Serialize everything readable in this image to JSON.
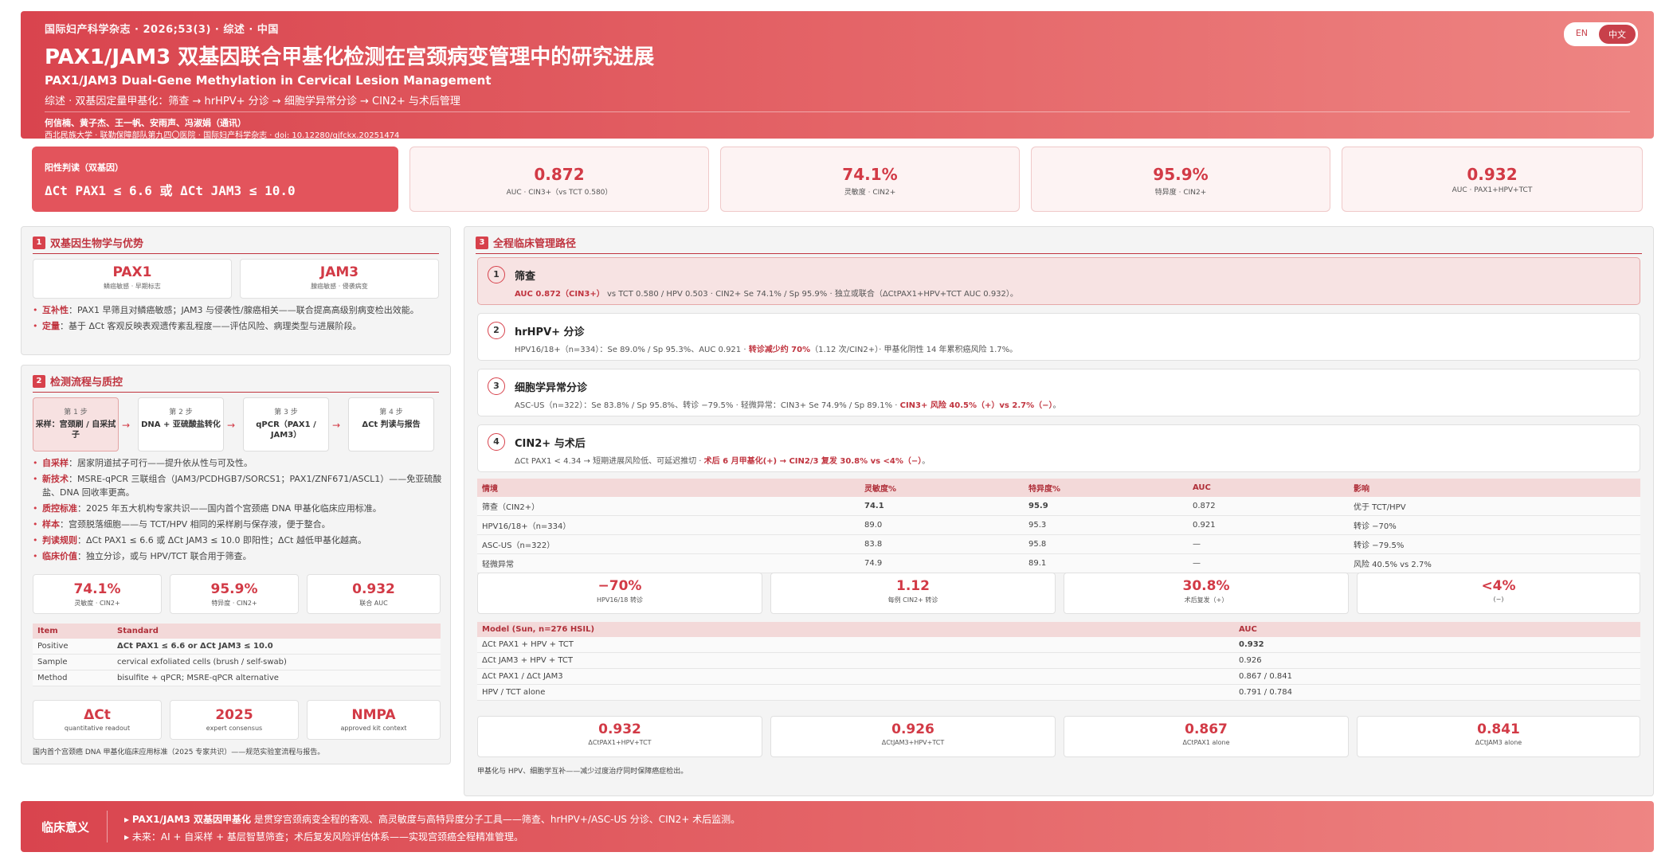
{
  "header": {
    "journal": "国际妇产科学杂志 · 2026;53(3) · 综述 · 中国",
    "title": "PAX1/JAM3 双基因联合甲基化检测在宫颈病变管理中的研究进展",
    "subtitle_en": "PAX1/JAM3 Dual-Gene Methylation in Cervical Lesion Management",
    "topic": "综述 · 双基因定量甲基化：筛查 → hrHPV+ 分诊 → 细胞学异常分诊 → CIN2+ 与术后管理",
    "authors": "何信楠、黄子杰、王一帆、安雨声、冯淑娟（通讯）",
    "affiliation": "西北民族大学 · 联勤保障部队第九四〇医院 · 国际妇产科学杂志 · doi: ",
    "doi": "10.12280/gjfckx.20251474",
    "lang_en": "EN",
    "lang_zh": "中文"
  },
  "kpis": {
    "main_label": "阳性判读（双基因）",
    "main_value": "ΔCt PAX1 ≤ 6.6 或 ΔCt JAM3 ≤ 10.0",
    "cards": [
      {
        "value": "0.872",
        "label": "AUC · CIN3+（vs TCT 0.580）"
      },
      {
        "value": "74.1%",
        "label": "灵敏度 · CIN2+"
      },
      {
        "value": "95.9%",
        "label": "特异度 · CIN2+"
      },
      {
        "value": "0.932",
        "label": "AUC · PAX1+HPV+TCT"
      }
    ]
  },
  "section1": {
    "num": "1",
    "title": "双基因生物学与优势",
    "genes": [
      {
        "name": "PAX1",
        "desc": "鳞癌敏感 · 早期标志"
      },
      {
        "name": "JAM3",
        "desc": "腺癌敏感 · 侵袭病变"
      }
    ],
    "bullets": [
      {
        "key": "互补性",
        "text": "：PAX1 早筛且对鳞癌敏感；JAM3 与侵袭性/腺癌相关——联合提高高级别病变检出效能。"
      },
      {
        "key": "定量",
        "text": "：基于 ΔCt 客观反映表观遗传紊乱程度——评估风险、病理类型与进展阶段。"
      }
    ]
  },
  "section2": {
    "num": "2",
    "title": "检测流程与质控",
    "steps": [
      {
        "n": "第 1 步",
        "t": "采样：宫颈刷 / 自采拭子"
      },
      {
        "n": "第 2 步",
        "t": "DNA + 亚硫酸盐转化"
      },
      {
        "n": "第 3 步",
        "t": "qPCR（PAX1 / JAM3）"
      },
      {
        "n": "第 4 步",
        "t": "ΔCt 判读与报告"
      }
    ],
    "arrow": "→",
    "bullets": [
      {
        "key": "自采样",
        "text": "：居家阴道拭子可行——提升依从性与可及性。"
      },
      {
        "key": "新技术",
        "text": "：MSRE-qPCR 三联组合（JAM3/PCDHGB7/SORCS1；PAX1/ZNF671/ASCL1）——免亚硫酸盐、DNA 回收率更高。"
      },
      {
        "key": "质控标准",
        "text": "：2025 年五大机构专家共识——国内首个宫颈癌 DNA 甲基化临床应用标准。"
      },
      {
        "key": "样本",
        "text": "：宫颈脱落细胞——与 TCT/HPV 相同的采样刷与保存液，便于整合。"
      },
      {
        "key": "判读规则",
        "text": "：ΔCt PAX1 ≤ 6.6 或 ΔCt JAM3 ≤ 10.0 即阳性；ΔCt 越低甲基化越高。"
      },
      {
        "key": "临床价值",
        "text": "：独立分诊，或与 HPV/TCT 联合用于筛查。"
      }
    ],
    "minis": [
      {
        "v": "74.1%",
        "l": "灵敏度 · CIN2+"
      },
      {
        "v": "95.9%",
        "l": "特异度 · CIN2+"
      },
      {
        "v": "0.932",
        "l": "联合 AUC"
      }
    ],
    "table": {
      "headers": [
        "Item",
        "Standard"
      ],
      "rows": [
        [
          "Positive",
          "ΔCt PAX1 ≤ 6.6 or ΔCt JAM3 ≤ 10.0"
        ],
        [
          "Sample",
          "cervical exfoliated cells (brush / self-swab)"
        ],
        [
          "Method",
          "bisulfite + qPCR; MSRE-qPCR alternative"
        ]
      ]
    },
    "minis2": [
      {
        "v": "ΔCt",
        "l": "quantitative readout"
      },
      {
        "v": "2025",
        "l": "expert consensus"
      },
      {
        "v": "NMPA",
        "l": "approved kit context"
      }
    ],
    "note": "国内首个宫颈癌 DNA 甲基化临床应用标准（2025 专家共识）——规范实验室流程与报告。"
  },
  "section3": {
    "num": "3",
    "title": "全程临床管理路径",
    "cards": [
      {
        "num": "1",
        "title": "筛查",
        "desc_pre": "",
        "desc_red": "AUC 0.872（CIN3+）",
        "desc_post": " vs TCT 0.580 / HPV 0.503 · CIN2+ Se 74.1% / Sp 95.9% · 独立或联合（ΔCtPAX1+HPV+TCT AUC 0.932）。"
      },
      {
        "num": "2",
        "title": "hrHPV+ 分诊",
        "desc_pre": "HPV16/18+（n=334）：Se 89.0% / Sp 95.3%、AUC 0.921 · ",
        "desc_red": "转诊减少约 70%",
        "desc_post": "（1.12 次/CIN2+）· 甲基化阴性 14 年累积癌风险 1.7%。"
      },
      {
        "num": "3",
        "title": "细胞学异常分诊",
        "desc_pre": "ASC-US（n=322）：Se 83.8% / Sp 95.8%、转诊 −79.5% · 轻微异常：CIN3+ Se 74.9% / Sp 89.1% · ",
        "desc_red": "CIN3+ 风险 40.5%（+）vs 2.7%（−）",
        "desc_post": "。"
      },
      {
        "num": "4",
        "title": "CIN2+ 与术后",
        "desc_pre": "ΔCt PAX1 < 4.34 → 短期进展风险低、可延迟推切 · ",
        "desc_red": "术后 6 月甲基化(+) → CIN2/3 复发 30.8% vs <4%（−）",
        "desc_post": "。"
      }
    ],
    "table1": {
      "headers": [
        "情境",
        "灵敏度%",
        "特异度%",
        "AUC",
        "影响"
      ],
      "rows": [
        [
          "筛查（CIN2+）",
          "74.1",
          "95.9",
          "0.872",
          "优于 TCT/HPV"
        ],
        [
          "HPV16/18+（n=334）",
          "89.0",
          "95.3",
          "0.921",
          "转诊 −70%"
        ],
        [
          "ASC-US（n=322）",
          "83.8",
          "95.8",
          "—",
          "转诊 −79.5%"
        ],
        [
          "轻微异常",
          "74.9",
          "89.1",
          "—",
          "风险 40.5% vs 2.7%"
        ]
      ]
    },
    "stats1": [
      {
        "v": "−70%",
        "l": "HPV16/18 转诊"
      },
      {
        "v": "1.12",
        "l": "每例 CIN2+ 转诊"
      },
      {
        "v": "30.8%",
        "l": "术后复发（+）"
      },
      {
        "v": "<4%",
        "l": "(−)"
      }
    ],
    "table2": {
      "headers": [
        "Model (Sun, n=276 HSIL)",
        "AUC"
      ],
      "rows": [
        [
          "ΔCt PAX1 + HPV + TCT",
          "0.932"
        ],
        [
          "ΔCt JAM3 + HPV + TCT",
          "0.926"
        ],
        [
          "ΔCt PAX1 / ΔCt JAM3",
          "0.867 / 0.841"
        ],
        [
          "HPV / TCT alone",
          "0.791 / 0.784"
        ]
      ]
    },
    "stats2": [
      {
        "v": "0.932",
        "l": "ΔCtPAX1+HPV+TCT"
      },
      {
        "v": "0.926",
        "l": "ΔCtJAM3+HPV+TCT"
      },
      {
        "v": "0.867",
        "l": "ΔCtPAX1 alone"
      },
      {
        "v": "0.841",
        "l": "ΔCtJAM3 alone"
      }
    ],
    "note": "甲基化与 HPV、细胞学互补——减少过度治疗同时保障癌症检出。"
  },
  "footer": {
    "title": "临床意义",
    "line1_bold": "PAX1/JAM3 双基因甲基化",
    "line1_rest": " 是贯穿宫颈病变全程的客观、高灵敏度与高特异度分子工具——筛查、hrHPV+/ASC-US 分诊、CIN2+ 术后监测。",
    "line2": "未来：AI + 自采样 + 基层智慧筛查；术后复发风险评估体系——实现宫颈癌全程精准管理。",
    "bullet": "▸"
  }
}
